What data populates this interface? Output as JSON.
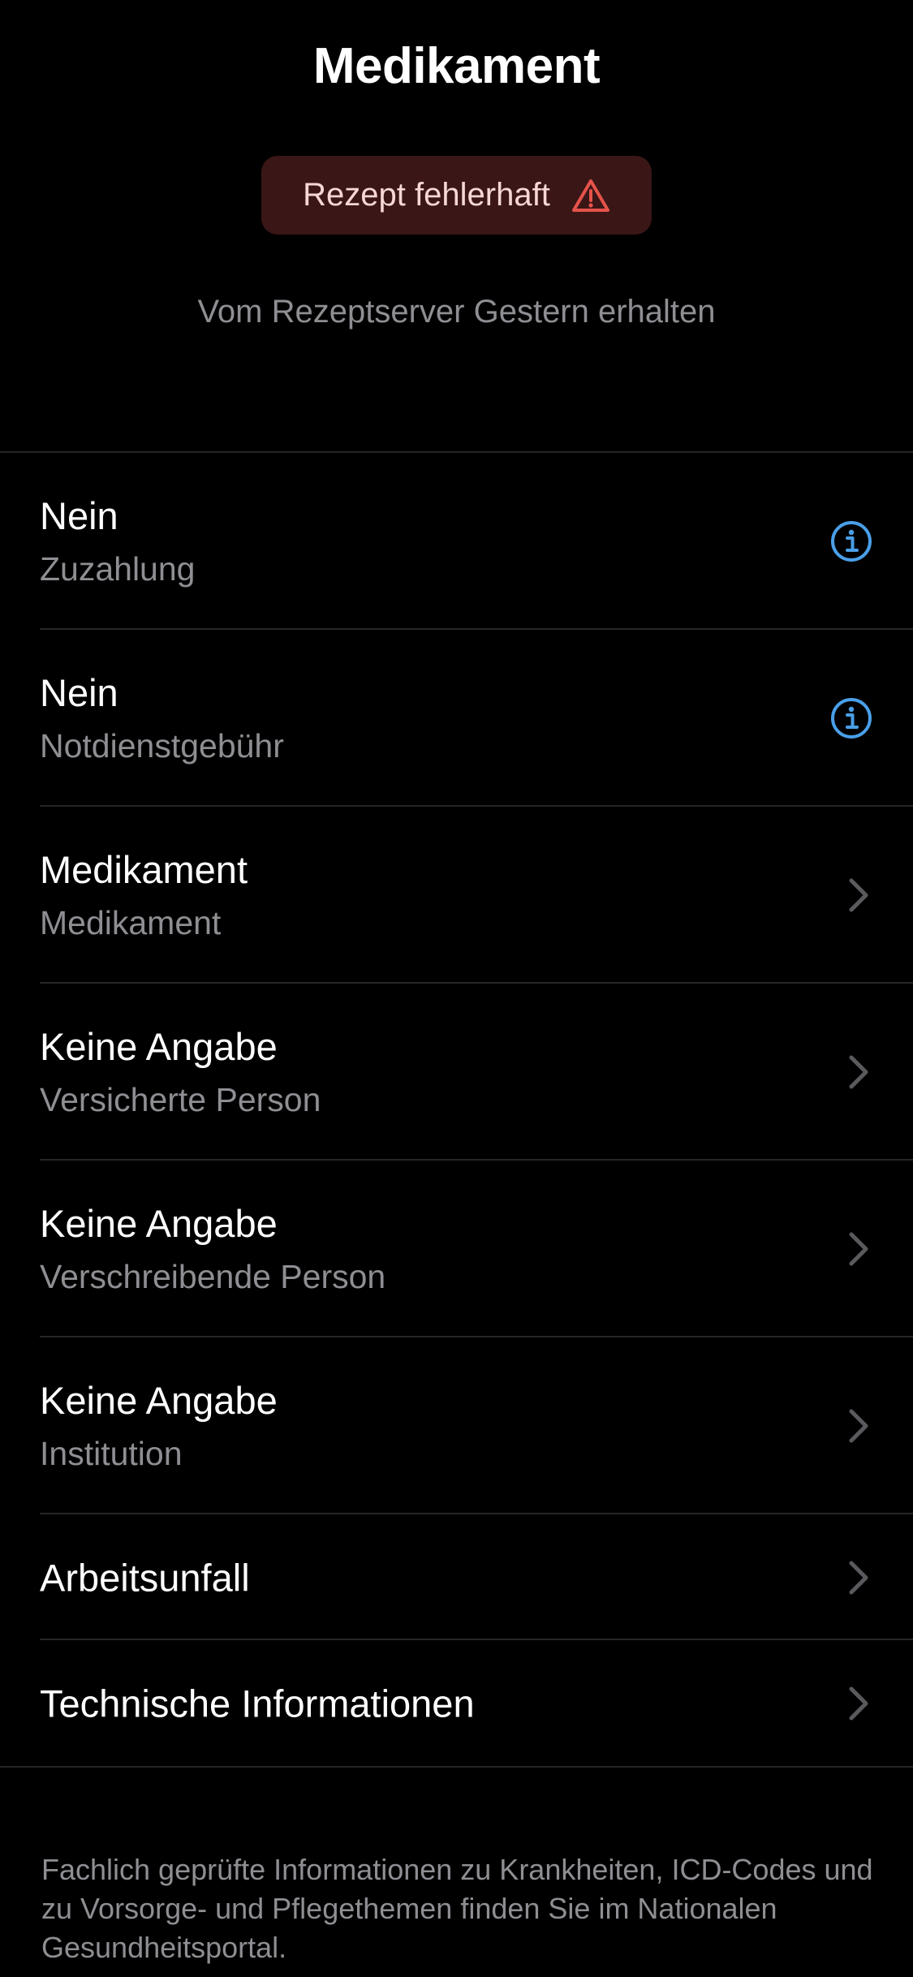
{
  "header": {
    "title": "Medikament"
  },
  "status_badge": {
    "label": "Rezept fehlerhaft",
    "icon": "warning-triangle-icon",
    "color": "#e5534b",
    "background": "#3a1616"
  },
  "received_info": "Vom Rezeptserver Gestern erhalten",
  "rows": [
    {
      "value": "Nein",
      "label": "Zuzahlung",
      "accessory": "info-icon"
    },
    {
      "value": "Nein",
      "label": "Notdienstgebühr",
      "accessory": "info-icon"
    },
    {
      "value": "Medikament",
      "label": "Medikament",
      "accessory": "chevron-right-icon"
    },
    {
      "value": "Keine Angabe",
      "label": "Versicherte Person",
      "accessory": "chevron-right-icon"
    },
    {
      "value": "Keine Angabe",
      "label": "Verschreibende Person",
      "accessory": "chevron-right-icon"
    },
    {
      "value": "Keine Angabe",
      "label": "Institution",
      "accessory": "chevron-right-icon"
    },
    {
      "value": "Arbeitsunfall",
      "accessory": "chevron-right-icon"
    },
    {
      "value": "Technische Informationen",
      "accessory": "chevron-right-icon"
    }
  ],
  "footer_text": "Fachlich geprüfte Informationen zu Krankheiten, ICD-Codes und zu Vorsorge- und Pflegethemen finden Sie im Nationalen Gesundheitsportal.",
  "colors": {
    "background": "#000000",
    "accent_blue": "#4a9fe8",
    "secondary_text": "#8e8e93",
    "separator": "#262628",
    "chevron": "#5a5a5e"
  }
}
